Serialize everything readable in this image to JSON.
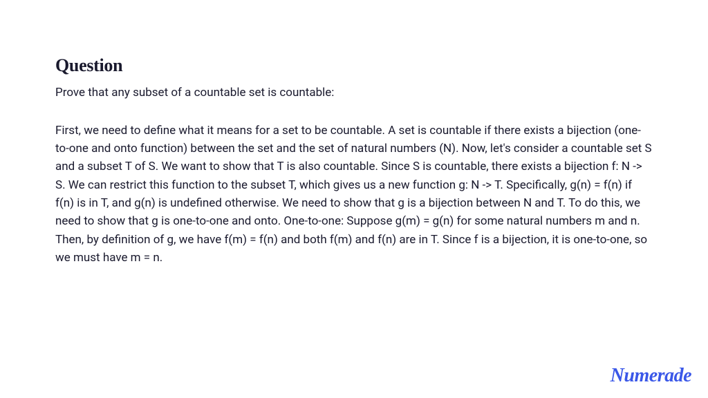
{
  "heading": "Question",
  "prompt": "Prove that any subset of a countable set is countable:",
  "body": "First, we need to define what it means for a set to be countable. A set is countable if there exists a bijection (one-to-one and onto function) between the set and the set of natural numbers (N). Now, let's consider a countable set S and a subset T of S. We want to show that T is also countable. Since S is countable, there exists a bijection f: N -> S. We can restrict this function to the subset T, which gives us a new function g: N -> T. Specifically, g(n) = f(n) if f(n) is in T, and g(n) is undefined otherwise. We need to show that g is a bijection between N and T. To do this, we need to show that g is one-to-one and onto. One-to-one: Suppose g(m) = g(n) for some natural numbers m and n. Then, by definition of g, we have f(m) = f(n) and both f(m) and f(n) are in T. Since f is a bijection, it is one-to-one, so we must have m = n.",
  "brand": "Numerade"
}
